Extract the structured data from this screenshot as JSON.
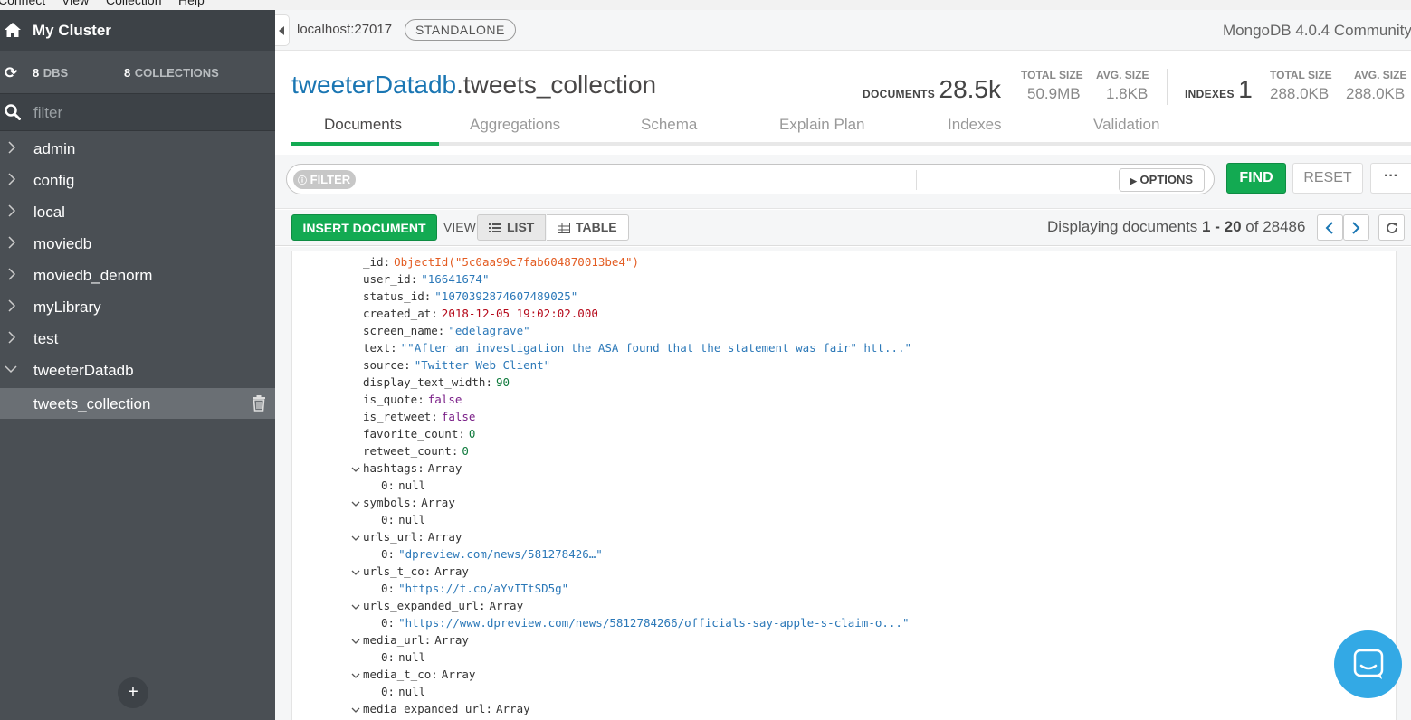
{
  "menubar": {
    "items": [
      "Connect",
      "View",
      "Collection",
      "Help"
    ]
  },
  "sidebar": {
    "cluster_name": "My Cluster",
    "dbs_count": "8",
    "dbs_label": "DBS",
    "collections_count": "8",
    "collections_label": "COLLECTIONS",
    "filter_placeholder": "filter",
    "databases": [
      "admin",
      "config",
      "local",
      "moviedb",
      "moviedb_denorm",
      "myLibrary",
      "test",
      "tweeterDatadb"
    ],
    "selected_collection": "tweets_collection",
    "add_label": "+"
  },
  "topbar": {
    "host": "localhost:27017",
    "topology": "STANDALONE",
    "version": "MongoDB 4.0.4 Community"
  },
  "header": {
    "db_name": "tweeterDatadb",
    "collection_name": ".tweets_collection",
    "documents_label": "DOCUMENTS",
    "documents_count": "28.5k",
    "total_size_label": "TOTAL SIZE",
    "total_size": "50.9MB",
    "avg_size_label": "AVG. SIZE",
    "avg_size": "1.8KB",
    "indexes_label": "INDEXES",
    "indexes_count": "1",
    "idx_total_size_label": "TOTAL SIZE",
    "idx_total_size": "288.0KB",
    "idx_avg_size_label": "AVG. SIZE",
    "idx_avg_size": "288.0KB"
  },
  "tabs": [
    "Documents",
    "Aggregations",
    "Schema",
    "Explain Plan",
    "Indexes",
    "Validation"
  ],
  "query": {
    "filter_badge": "FILTER",
    "options_label": "OPTIONS",
    "find_label": "FIND",
    "reset_label": "RESET",
    "more_label": "···"
  },
  "toolbar": {
    "insert_label": "INSERT DOCUMENT",
    "view_label": "VIEW",
    "list_label": "LIST",
    "table_label": "TABLE",
    "display_prefix": "Displaying documents",
    "range": "1 - 20",
    "of_label": "of",
    "total": "28486"
  },
  "document": [
    {
      "key": "_id",
      "value": "ObjectId(\"5c0aa99c7fab604870013be4\")",
      "type": "oid",
      "indent": 0
    },
    {
      "key": "user_id",
      "value": "\"16641674\"",
      "type": "string",
      "indent": 0
    },
    {
      "key": "status_id",
      "value": "\"1070392874607489025\"",
      "type": "string",
      "indent": 0
    },
    {
      "key": "created_at",
      "value": "2018-12-05 19:02:02.000",
      "type": "date",
      "indent": 0
    },
    {
      "key": "screen_name",
      "value": "\"edelagrave\"",
      "type": "string",
      "indent": 0
    },
    {
      "key": "text",
      "value": "\"\"After an investigation the ASA found that the statement was fair\" htt...\"",
      "type": "string",
      "indent": 0
    },
    {
      "key": "source",
      "value": "\"Twitter Web Client\"",
      "type": "string",
      "indent": 0
    },
    {
      "key": "display_text_width",
      "value": "90",
      "type": "num",
      "indent": 0
    },
    {
      "key": "is_quote",
      "value": "false",
      "type": "bool",
      "indent": 0
    },
    {
      "key": "is_retweet",
      "value": "false",
      "type": "bool",
      "indent": 0
    },
    {
      "key": "favorite_count",
      "value": "0",
      "type": "num",
      "indent": 0
    },
    {
      "key": "retweet_count",
      "value": "0",
      "type": "num",
      "indent": 0
    },
    {
      "key": "hashtags",
      "value": "Array",
      "type": "type",
      "indent": 0,
      "expander": true
    },
    {
      "key": "0",
      "value": "null",
      "type": "type",
      "indent": 1
    },
    {
      "key": "symbols",
      "value": "Array",
      "type": "type",
      "indent": 0,
      "expander": true
    },
    {
      "key": "0",
      "value": "null",
      "type": "type",
      "indent": 1
    },
    {
      "key": "urls_url",
      "value": "Array",
      "type": "type",
      "indent": 0,
      "expander": true
    },
    {
      "key": "0",
      "value": "\"dpreview.com/news/581278426…\"",
      "type": "string",
      "indent": 1
    },
    {
      "key": "urls_t_co",
      "value": "Array",
      "type": "type",
      "indent": 0,
      "expander": true
    },
    {
      "key": "0",
      "value": "\"https://t.co/aYvITtSD5g\"",
      "type": "string",
      "indent": 1
    },
    {
      "key": "urls_expanded_url",
      "value": "Array",
      "type": "type",
      "indent": 0,
      "expander": true
    },
    {
      "key": "0",
      "value": "\"https://www.dpreview.com/news/5812784266/officials-say-apple-s-claim-o...\"",
      "type": "string",
      "indent": 1
    },
    {
      "key": "media_url",
      "value": "Array",
      "type": "type",
      "indent": 0,
      "expander": true
    },
    {
      "key": "0",
      "value": "null",
      "type": "type",
      "indent": 1
    },
    {
      "key": "media_t_co",
      "value": "Array",
      "type": "type",
      "indent": 0,
      "expander": true
    },
    {
      "key": "0",
      "value": "null",
      "type": "type",
      "indent": 1
    },
    {
      "key": "media_expanded_url",
      "value": "Array",
      "type": "type",
      "indent": 0,
      "expander": true
    }
  ],
  "colors": {
    "sidebar_bg": "#4a4f54",
    "accent_green": "#13aa52",
    "db_blue": "#1a76b3",
    "chat_blue": "#33a9e5"
  }
}
